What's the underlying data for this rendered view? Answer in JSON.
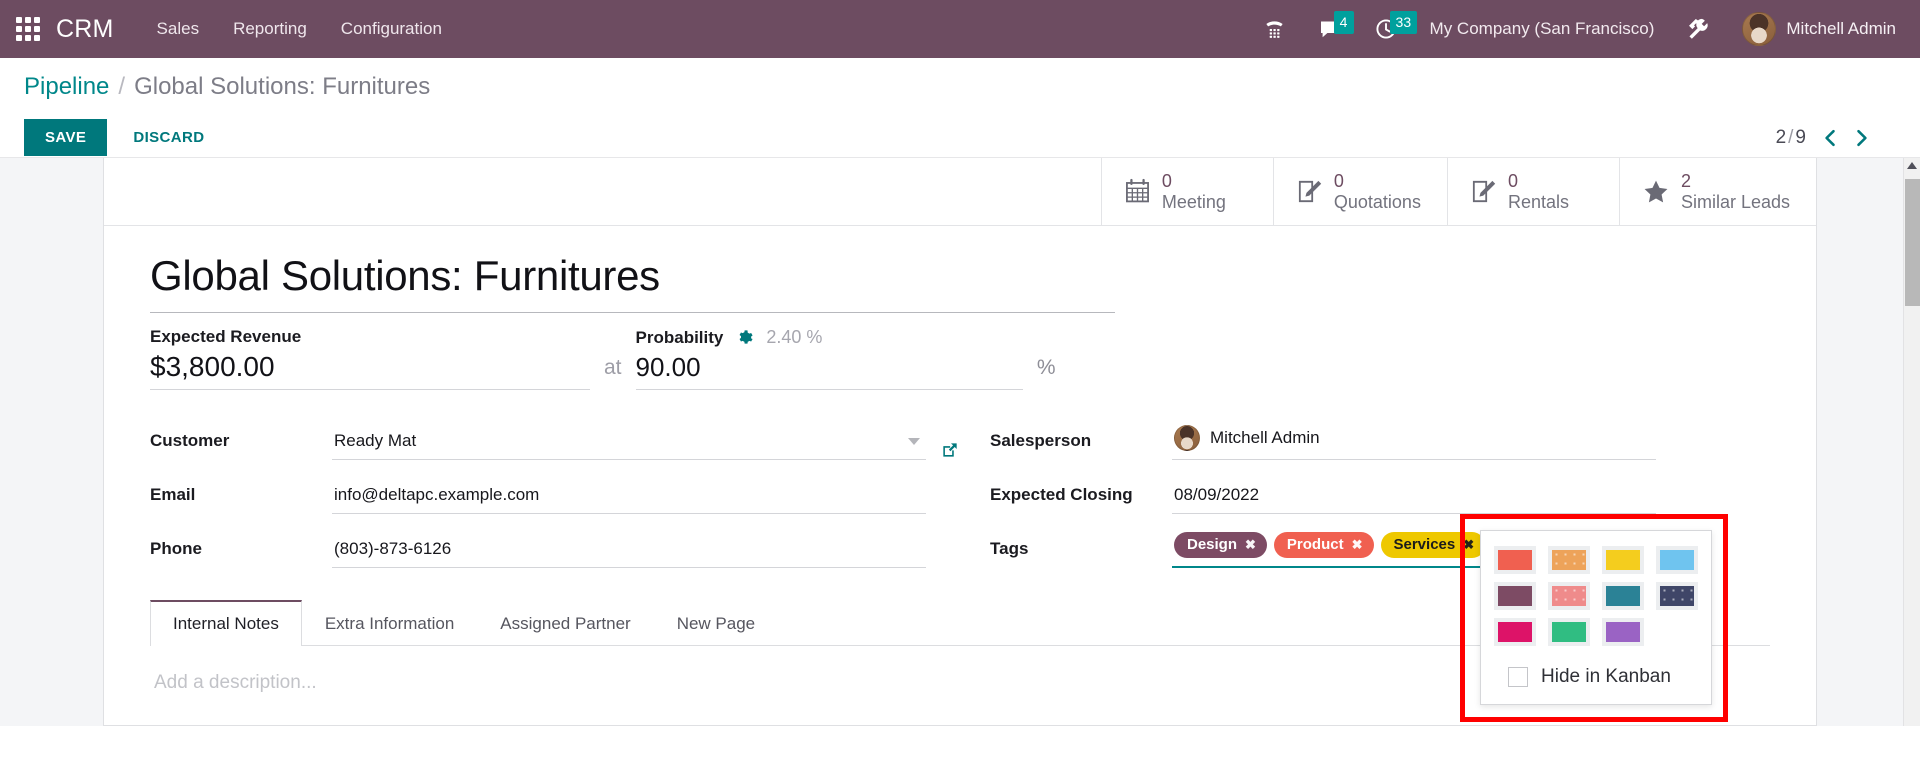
{
  "navbar": {
    "apps_icon": "apps-grid-icon",
    "brand": "CRM",
    "menus": [
      {
        "label": "Sales"
      },
      {
        "label": "Reporting"
      },
      {
        "label": "Configuration"
      }
    ],
    "sys_icons": [
      {
        "name": "dialpad-icon",
        "glyph": "☎",
        "badge": null
      },
      {
        "name": "messages-icon",
        "glyph": "ὊC",
        "badge": "4"
      },
      {
        "name": "activities-clock-icon",
        "glyph": "⏱",
        "badge": "33"
      }
    ],
    "messages_badge": "4",
    "activities_badge": "33",
    "company": "My Company (San Francisco)",
    "debug_icon": "tools-wrench-icon",
    "user_name": "Mitchell Admin",
    "avatar": "user-avatar"
  },
  "control_panel": {
    "breadcrumb_root": "Pipeline",
    "breadcrumb_sep": "/",
    "breadcrumb_current": "Global Solutions: Furnitures",
    "save_label": "SAVE",
    "discard_label": "DISCARD",
    "pager_current": "2",
    "pager_sep": "/",
    "pager_total": "9",
    "pager_prev_icon": "chevron-left-icon",
    "pager_next_icon": "chevron-right-icon"
  },
  "stat_buttons": [
    {
      "icon": "calendar-icon",
      "value": "0",
      "label": "Meeting"
    },
    {
      "icon": "quotation-pencil-icon",
      "value": "0",
      "label": "Quotations"
    },
    {
      "icon": "rental-pencil-icon",
      "value": "0",
      "label": "Rentals"
    },
    {
      "icon": "star-icon",
      "value": "2",
      "label": "Similar Leads"
    }
  ],
  "form": {
    "title": "Global Solutions: Furnitures",
    "expected_revenue_label": "Expected Revenue",
    "expected_revenue_value": "$3,800.00",
    "at_word": "at",
    "probability_label": "Probability",
    "probability_gear_icon": "gear-icon",
    "probability_auto": "2.40 %",
    "probability_value": "90.00",
    "percent_sign": "%",
    "customer_label": "Customer",
    "customer_value": "Ready Mat",
    "email_label": "Email",
    "email_value": "info@deltapc.example.com",
    "phone_label": "Phone",
    "phone_value": "(803)-873-6126",
    "salesperson_label": "Salesperson",
    "salesperson_value": "Mitchell Admin",
    "expected_closing_label": "Expected Closing",
    "expected_closing_value": "08/09/2022",
    "tags_label": "Tags",
    "tags": [
      {
        "label": "Design",
        "color": "#7d4b64",
        "text_color": "#ffffff",
        "remove_icon": "tag-remove-icon"
      },
      {
        "label": "Product",
        "color": "#f06050",
        "text_color": "#ffffff",
        "remove_icon": "tag-remove-icon"
      },
      {
        "label": "Services",
        "color": "#eec800",
        "text_color": "#1b1b1b",
        "remove_icon": "tag-remove-icon"
      }
    ]
  },
  "color_picker": {
    "highlight_color": "#ff0000",
    "swatches": [
      {
        "name": "swatch-red",
        "color": "#f06050",
        "dotted": false
      },
      {
        "name": "swatch-orange",
        "color": "#eda35a",
        "dotted": true
      },
      {
        "name": "swatch-yellow",
        "color": "#f4cd1e",
        "dotted": false
      },
      {
        "name": "swatch-light-blue",
        "color": "#6fc4ef",
        "dotted": false
      },
      {
        "name": "swatch-plum",
        "color": "#7d4b64",
        "dotted": false
      },
      {
        "name": "swatch-salmon",
        "color": "#ef8b8b",
        "dotted": true
      },
      {
        "name": "swatch-teal",
        "color": "#2b8296",
        "dotted": false
      },
      {
        "name": "swatch-navy",
        "color": "#3f4668",
        "dotted": true
      },
      {
        "name": "swatch-magenta",
        "color": "#dd1368",
        "dotted": false
      },
      {
        "name": "swatch-green",
        "color": "#30bd82",
        "dotted": false
      },
      {
        "name": "swatch-purple",
        "color": "#9a63c4",
        "dotted": false
      }
    ],
    "hide_in_kanban_label": "Hide in Kanban",
    "hide_in_kanban_checked": false
  },
  "notebook": {
    "tabs": [
      {
        "label": "Internal Notes",
        "active": true
      },
      {
        "label": "Extra Information",
        "active": false
      },
      {
        "label": "Assigned Partner",
        "active": false
      },
      {
        "label": "New Page",
        "active": false
      }
    ],
    "description_placeholder": "Add a description..."
  },
  "scrollbar": {
    "up_arrow_icon": "scroll-up-arrow-icon",
    "thumb": "scroll-thumb"
  }
}
